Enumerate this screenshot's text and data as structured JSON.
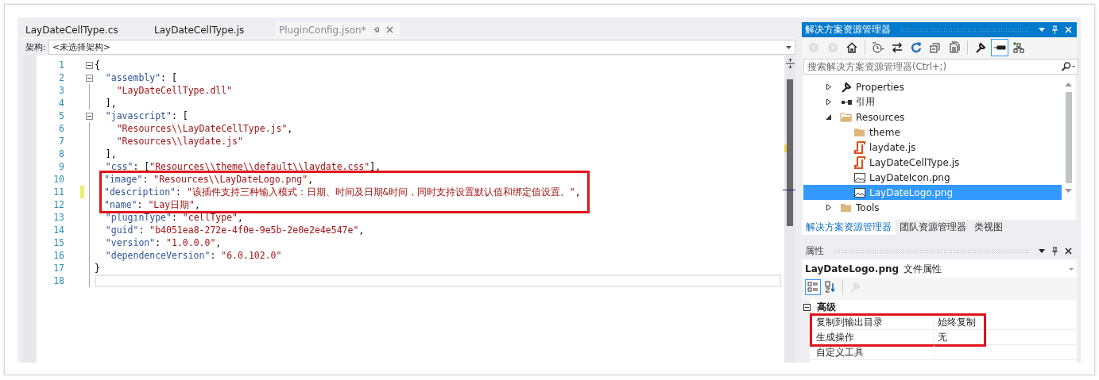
{
  "editor": {
    "tabs": [
      {
        "label": "LayDateCellType.cs",
        "selected": false
      },
      {
        "label": "LayDateCellType.js",
        "selected": false
      },
      {
        "label": "PluginConfig.json*",
        "selected": true
      }
    ],
    "nav": {
      "label": "架构:",
      "value": "<未选择架构>"
    },
    "code_blocks": [
      {
        "boxed": false,
        "lines": [
          {
            "number": "1",
            "fold": true,
            "changed": false,
            "current": false,
            "segments": [
              {
                "kind": "punct",
                "text": "{"
              }
            ]
          },
          {
            "number": "2",
            "fold": true,
            "changed": false,
            "current": false,
            "segments": [
              {
                "kind": "key",
                "text": "  \"assembly\""
              },
              {
                "kind": "punct",
                "text": ": ["
              }
            ]
          },
          {
            "number": "3",
            "fold": false,
            "changed": false,
            "current": false,
            "segments": [
              {
                "kind": "string",
                "text": "    \"LayDateCellType.dll\""
              }
            ]
          },
          {
            "number": "4",
            "fold": false,
            "changed": false,
            "current": false,
            "segments": [
              {
                "kind": "punct",
                "text": "  ],"
              }
            ]
          },
          {
            "number": "5",
            "fold": true,
            "changed": false,
            "current": false,
            "segments": [
              {
                "kind": "key",
                "text": "  \"javascript\""
              },
              {
                "kind": "punct",
                "text": ": ["
              }
            ]
          },
          {
            "number": "6",
            "fold": false,
            "changed": false,
            "current": false,
            "segments": [
              {
                "kind": "string",
                "text": "    \"Resources\\\\LayDateCellType.js\""
              },
              {
                "kind": "punct",
                "text": ","
              }
            ]
          },
          {
            "number": "7",
            "fold": false,
            "changed": false,
            "current": false,
            "segments": [
              {
                "kind": "string",
                "text": "    \"Resources\\\\laydate.js\""
              }
            ]
          },
          {
            "number": "8",
            "fold": false,
            "changed": false,
            "current": false,
            "segments": [
              {
                "kind": "punct",
                "text": "  ],"
              }
            ]
          },
          {
            "number": "9",
            "fold": false,
            "changed": false,
            "current": false,
            "segments": [
              {
                "kind": "key",
                "text": "  \"css\""
              },
              {
                "kind": "punct",
                "text": ": ["
              },
              {
                "kind": "string",
                "text": "\"Resources\\\\theme\\\\default\\\\laydate.css\""
              },
              {
                "kind": "punct",
                "text": "],"
              }
            ]
          }
        ]
      },
      {
        "boxed": true,
        "lines": [
          {
            "number": "10",
            "fold": false,
            "changed": false,
            "current": false,
            "segments": [
              {
                "kind": "key",
                "text": "\"image\""
              },
              {
                "kind": "punct",
                "text": ": "
              },
              {
                "kind": "string",
                "text": "\"Resources\\\\LayDateLogo.png\""
              },
              {
                "kind": "punct",
                "text": ","
              }
            ]
          },
          {
            "number": "11",
            "fold": false,
            "changed": true,
            "current": false,
            "segments": [
              {
                "kind": "key",
                "text": "\"description\""
              },
              {
                "kind": "punct",
                "text": ": "
              },
              {
                "kind": "string",
                "text": "\"该插件支持三种输入模式：日期、时间及日期&时间，同时支持设置默认值和绑定值设置。\""
              },
              {
                "kind": "punct",
                "text": ","
              }
            ]
          },
          {
            "number": "12",
            "fold": false,
            "changed": false,
            "current": false,
            "segments": [
              {
                "kind": "key",
                "text": "\"name\""
              },
              {
                "kind": "punct",
                "text": ": "
              },
              {
                "kind": "string",
                "text": "\"Lay日期\""
              },
              {
                "kind": "punct",
                "text": ","
              }
            ]
          }
        ]
      },
      {
        "boxed": false,
        "lines": [
          {
            "number": "13",
            "fold": false,
            "changed": false,
            "current": false,
            "segments": [
              {
                "kind": "key",
                "text": "  \"pluginType\""
              },
              {
                "kind": "punct",
                "text": ": "
              },
              {
                "kind": "string",
                "text": "\"cellType\""
              },
              {
                "kind": "punct",
                "text": ","
              }
            ]
          },
          {
            "number": "14",
            "fold": false,
            "changed": false,
            "current": false,
            "segments": [
              {
                "kind": "key",
                "text": "  \"guid\""
              },
              {
                "kind": "punct",
                "text": ": "
              },
              {
                "kind": "string",
                "text": "\"b4051ea8-272e-4f0e-9e5b-2e0e2e4e547e\""
              },
              {
                "kind": "punct",
                "text": ","
              }
            ]
          },
          {
            "number": "15",
            "fold": false,
            "changed": false,
            "current": false,
            "segments": [
              {
                "kind": "key",
                "text": "  \"version\""
              },
              {
                "kind": "punct",
                "text": ": "
              },
              {
                "kind": "string",
                "text": "\"1.0.0.0\""
              },
              {
                "kind": "punct",
                "text": ","
              }
            ]
          },
          {
            "number": "16",
            "fold": false,
            "changed": false,
            "current": false,
            "segments": [
              {
                "kind": "key",
                "text": "  \"dependenceVersion\""
              },
              {
                "kind": "punct",
                "text": ": "
              },
              {
                "kind": "string",
                "text": "\"6.0.102.0\""
              }
            ]
          },
          {
            "number": "17",
            "fold": false,
            "changed": false,
            "current": false,
            "segments": [
              {
                "kind": "punct",
                "text": "}"
              }
            ]
          },
          {
            "number": "18",
            "fold": false,
            "changed": false,
            "current": true
          }
        ]
      }
    ]
  },
  "solution_explorer": {
    "title": "解决方案资源管理器",
    "toolbar": [
      {
        "kind": "back",
        "disabled": true,
        "pressed": false
      },
      {
        "kind": "forward",
        "disabled": true,
        "pressed": false
      },
      {
        "kind": "home",
        "disabled": false,
        "pressed": false
      },
      {
        "kind": "history",
        "disabled": false,
        "pressed": false
      },
      {
        "kind": "sync",
        "disabled": false,
        "pressed": false
      },
      {
        "kind": "refresh",
        "disabled": false,
        "pressed": false
      },
      {
        "kind": "collapse",
        "disabled": false,
        "pressed": false
      },
      {
        "kind": "show-all",
        "disabled": false,
        "pressed": false
      },
      {
        "kind": "properties",
        "disabled": false,
        "pressed": false
      },
      {
        "kind": "preview",
        "disabled": false,
        "pressed": true
      },
      {
        "kind": "new-view",
        "disabled": false,
        "pressed": false
      }
    ],
    "search": {
      "placeholder": "搜索解决方案资源管理器(Ctrl+;)"
    },
    "tree": [
      {
        "label": "Properties",
        "kind": "wrench",
        "expanded": false,
        "selected": false
      },
      {
        "label": "引用",
        "kind": "references",
        "expanded": false,
        "selected": false
      },
      {
        "label": "Resources",
        "kind": "folder",
        "expanded": true,
        "selected": false,
        "children": [
          {
            "label": "theme",
            "kind": "folder",
            "selected": false
          },
          {
            "label": "laydate.js",
            "kind": "script",
            "selected": false
          },
          {
            "label": "LayDateCellType.js",
            "kind": "script",
            "selected": false
          },
          {
            "label": "LayDateIcon.png",
            "kind": "image",
            "selected": false
          },
          {
            "label": "LayDateLogo.png",
            "kind": "image",
            "selected": true
          }
        ]
      },
      {
        "label": "Tools",
        "kind": "folder",
        "expanded": false,
        "selected": false
      }
    ],
    "tabs": [
      {
        "label": "解决方案资源管理器",
        "selected": true
      },
      {
        "label": "团队资源管理器",
        "selected": false
      },
      {
        "label": "类视图",
        "selected": false
      }
    ]
  },
  "properties": {
    "title": "属性",
    "object": {
      "name": "LayDateLogo.png",
      "type": "文件属性"
    },
    "toolbar": [
      {
        "kind": "categorized",
        "pressed": true,
        "disabled": false
      },
      {
        "kind": "alphabetical",
        "pressed": false,
        "disabled": false
      },
      {
        "kind": "property-pages",
        "pressed": false,
        "disabled": true
      }
    ],
    "category": {
      "label": "高级",
      "expanded": true
    },
    "row_blocks": [
      {
        "boxed": true,
        "rows": [
          {
            "name": "复制到输出目录",
            "value": "始终复制"
          },
          {
            "name": "生成操作",
            "value": "无"
          }
        ]
      },
      {
        "boxed": false,
        "rows": [
          {
            "name": "自定义工具"
          }
        ]
      }
    ]
  }
}
